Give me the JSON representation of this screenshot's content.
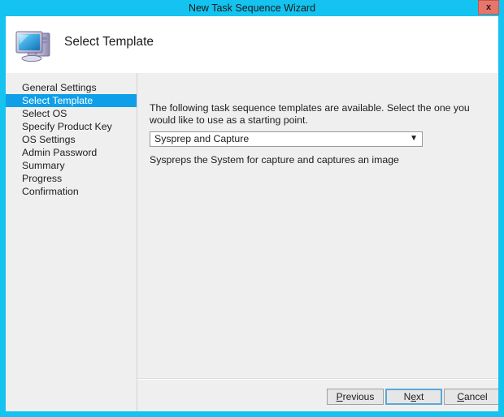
{
  "window": {
    "title": "New Task Sequence Wizard",
    "close_label": "x",
    "accent_color": "#14c3ef",
    "close_color": "#e8756b"
  },
  "header": {
    "title": "Select Template",
    "icon": "computer-icon"
  },
  "sidebar": {
    "items": [
      {
        "label": "General Settings",
        "selected": false
      },
      {
        "label": "Select Template",
        "selected": true
      },
      {
        "label": "Select OS",
        "selected": false
      },
      {
        "label": "Specify Product Key",
        "selected": false
      },
      {
        "label": "OS Settings",
        "selected": false
      },
      {
        "label": "Admin Password",
        "selected": false
      },
      {
        "label": "Summary",
        "selected": false
      },
      {
        "label": "Progress",
        "selected": false
      },
      {
        "label": "Confirmation",
        "selected": false
      }
    ],
    "selected_color": "#0f9fe8"
  },
  "content": {
    "intro": "The following task sequence templates are available.  Select the one you would like to use as a starting point.",
    "template_dropdown": {
      "value": "Sysprep and Capture",
      "chevron": "chevron-down-icon"
    },
    "template_description": "Syspreps the System for capture and captures an image"
  },
  "buttons": {
    "previous": {
      "prefix": "",
      "accel": "P",
      "suffix": "revious"
    },
    "next": {
      "prefix": "N",
      "accel": "e",
      "suffix": "xt",
      "is_default": true
    },
    "cancel": {
      "prefix": "",
      "accel": "C",
      "suffix": "ancel"
    }
  }
}
